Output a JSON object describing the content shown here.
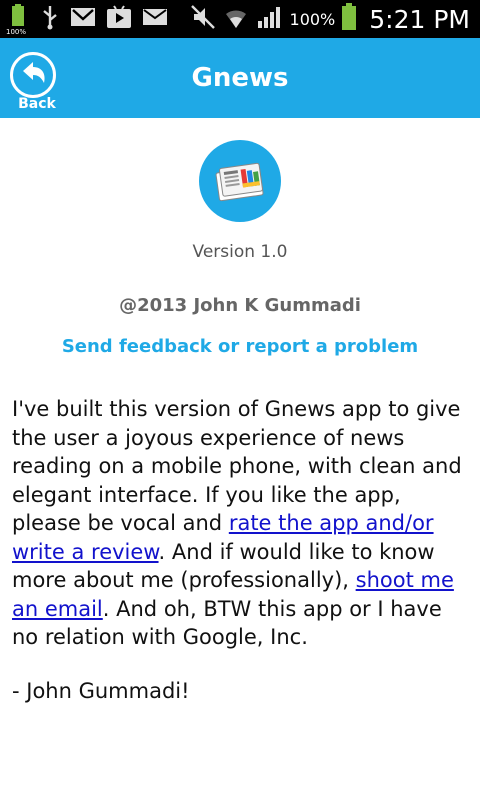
{
  "status_bar": {
    "battery_small_label": "100%",
    "battery_percent": "100%",
    "time": "5:21 PM",
    "icons": [
      "battery-charging-icon",
      "usb-icon",
      "gmail-icon",
      "play-store-icon",
      "email-icon",
      "mute-icon",
      "wifi-icon",
      "signal-icon",
      "battery-icon"
    ]
  },
  "action_bar": {
    "back_label": "Back",
    "title": "Gnews",
    "color": "#1FA9E6"
  },
  "content": {
    "app_icon": "gnews-app-icon",
    "version": "Version 1.0",
    "copyright": "@2013 John K Gummadi",
    "feedback_link": "Send feedback or report a problem",
    "about": {
      "part1": "I've built this version of Gnews app to give the user a joyous experience of news reading on a mobile phone, with clean and elegant interface. If you like the app, please be vocal and ",
      "link_rate": "rate the app and/or write a review",
      "part2": ". And if would like to know more about me (professionally), ",
      "link_email": "shoot me an email",
      "part3": ". And oh, BTW this app or I have no relation with Google, Inc."
    },
    "signature": "- John Gummadi!"
  }
}
